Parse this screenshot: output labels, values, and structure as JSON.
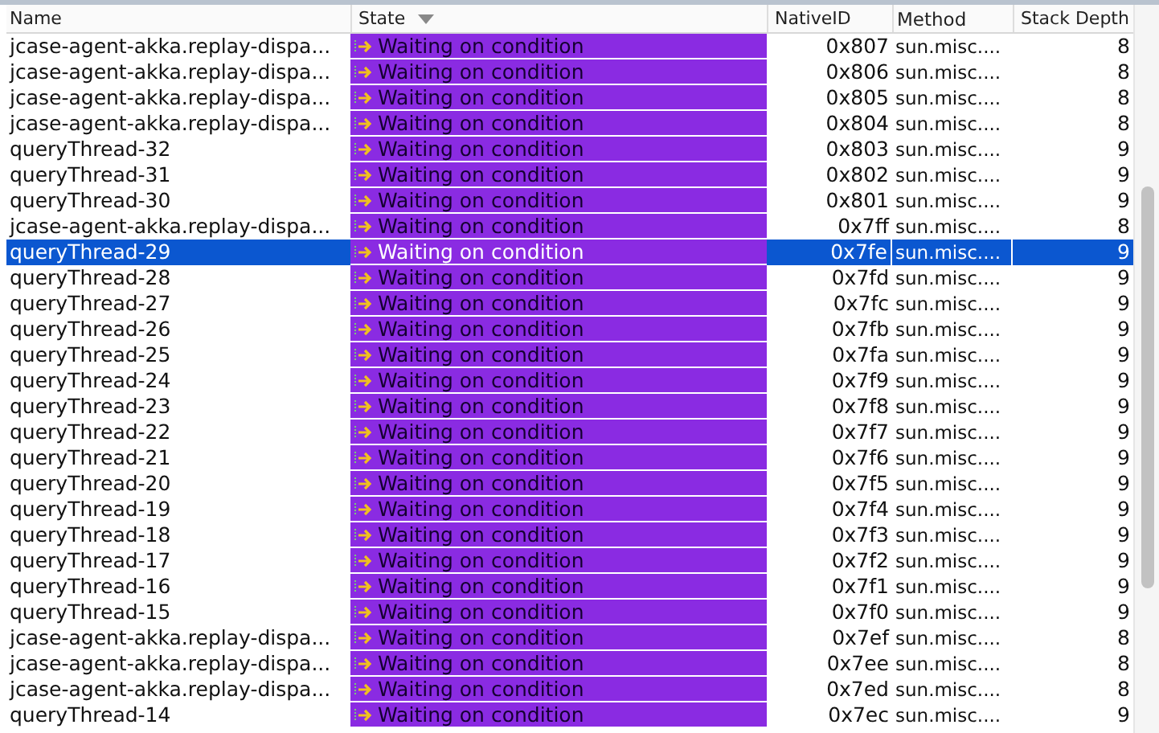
{
  "table": {
    "columns": [
      {
        "label": "Name"
      },
      {
        "label": "State",
        "sorted": true
      },
      {
        "label": "NativeID"
      },
      {
        "label": "Method"
      },
      {
        "label": "Stack Depth"
      }
    ],
    "rows": [
      {
        "name": "jcase-agent-akka.replay-dispa...",
        "state": "Waiting on condition",
        "native_id": "0x807",
        "method": "sun.misc....",
        "stack_depth": "8",
        "selected": false
      },
      {
        "name": "jcase-agent-akka.replay-dispa...",
        "state": "Waiting on condition",
        "native_id": "0x806",
        "method": "sun.misc....",
        "stack_depth": "8",
        "selected": false
      },
      {
        "name": "jcase-agent-akka.replay-dispa...",
        "state": "Waiting on condition",
        "native_id": "0x805",
        "method": "sun.misc....",
        "stack_depth": "8",
        "selected": false
      },
      {
        "name": "jcase-agent-akka.replay-dispa...",
        "state": "Waiting on condition",
        "native_id": "0x804",
        "method": "sun.misc....",
        "stack_depth": "8",
        "selected": false
      },
      {
        "name": "queryThread-32",
        "state": "Waiting on condition",
        "native_id": "0x803",
        "method": "sun.misc....",
        "stack_depth": "9",
        "selected": false
      },
      {
        "name": "queryThread-31",
        "state": "Waiting on condition",
        "native_id": "0x802",
        "method": "sun.misc....",
        "stack_depth": "9",
        "selected": false
      },
      {
        "name": "queryThread-30",
        "state": "Waiting on condition",
        "native_id": "0x801",
        "method": "sun.misc....",
        "stack_depth": "9",
        "selected": false
      },
      {
        "name": "jcase-agent-akka.replay-dispa...",
        "state": "Waiting on condition",
        "native_id": "0x7ff",
        "method": "sun.misc....",
        "stack_depth": "8",
        "selected": false
      },
      {
        "name": "queryThread-29",
        "state": "Waiting on condition",
        "native_id": "0x7fe",
        "method": "sun.misc....",
        "stack_depth": "9",
        "selected": true
      },
      {
        "name": "queryThread-28",
        "state": "Waiting on condition",
        "native_id": "0x7fd",
        "method": "sun.misc....",
        "stack_depth": "9",
        "selected": false
      },
      {
        "name": "queryThread-27",
        "state": "Waiting on condition",
        "native_id": "0x7fc",
        "method": "sun.misc....",
        "stack_depth": "9",
        "selected": false
      },
      {
        "name": "queryThread-26",
        "state": "Waiting on condition",
        "native_id": "0x7fb",
        "method": "sun.misc....",
        "stack_depth": "9",
        "selected": false
      },
      {
        "name": "queryThread-25",
        "state": "Waiting on condition",
        "native_id": "0x7fa",
        "method": "sun.misc....",
        "stack_depth": "9",
        "selected": false
      },
      {
        "name": "queryThread-24",
        "state": "Waiting on condition",
        "native_id": "0x7f9",
        "method": "sun.misc....",
        "stack_depth": "9",
        "selected": false
      },
      {
        "name": "queryThread-23",
        "state": "Waiting on condition",
        "native_id": "0x7f8",
        "method": "sun.misc....",
        "stack_depth": "9",
        "selected": false
      },
      {
        "name": "queryThread-22",
        "state": "Waiting on condition",
        "native_id": "0x7f7",
        "method": "sun.misc....",
        "stack_depth": "9",
        "selected": false
      },
      {
        "name": "queryThread-21",
        "state": "Waiting on condition",
        "native_id": "0x7f6",
        "method": "sun.misc....",
        "stack_depth": "9",
        "selected": false
      },
      {
        "name": "queryThread-20",
        "state": "Waiting on condition",
        "native_id": "0x7f5",
        "method": "sun.misc....",
        "stack_depth": "9",
        "selected": false
      },
      {
        "name": "queryThread-19",
        "state": "Waiting on condition",
        "native_id": "0x7f4",
        "method": "sun.misc....",
        "stack_depth": "9",
        "selected": false
      },
      {
        "name": "queryThread-18",
        "state": "Waiting on condition",
        "native_id": "0x7f3",
        "method": "sun.misc....",
        "stack_depth": "9",
        "selected": false
      },
      {
        "name": "queryThread-17",
        "state": "Waiting on condition",
        "native_id": "0x7f2",
        "method": "sun.misc....",
        "stack_depth": "9",
        "selected": false
      },
      {
        "name": "queryThread-16",
        "state": "Waiting on condition",
        "native_id": "0x7f1",
        "method": "sun.misc....",
        "stack_depth": "9",
        "selected": false
      },
      {
        "name": "queryThread-15",
        "state": "Waiting on condition",
        "native_id": "0x7f0",
        "method": "sun.misc....",
        "stack_depth": "9",
        "selected": false
      },
      {
        "name": "jcase-agent-akka.replay-dispa...",
        "state": "Waiting on condition",
        "native_id": "0x7ef",
        "method": "sun.misc....",
        "stack_depth": "8",
        "selected": false
      },
      {
        "name": "jcase-agent-akka.replay-dispa...",
        "state": "Waiting on condition",
        "native_id": "0x7ee",
        "method": "sun.misc....",
        "stack_depth": "8",
        "selected": false
      },
      {
        "name": "jcase-agent-akka.replay-dispa...",
        "state": "Waiting on condition",
        "native_id": "0x7ed",
        "method": "sun.misc....",
        "stack_depth": "8",
        "selected": false
      },
      {
        "name": "queryThread-14",
        "state": "Waiting on condition",
        "native_id": "0x7ec",
        "method": "sun.misc....",
        "stack_depth": "9",
        "selected": false
      }
    ]
  }
}
